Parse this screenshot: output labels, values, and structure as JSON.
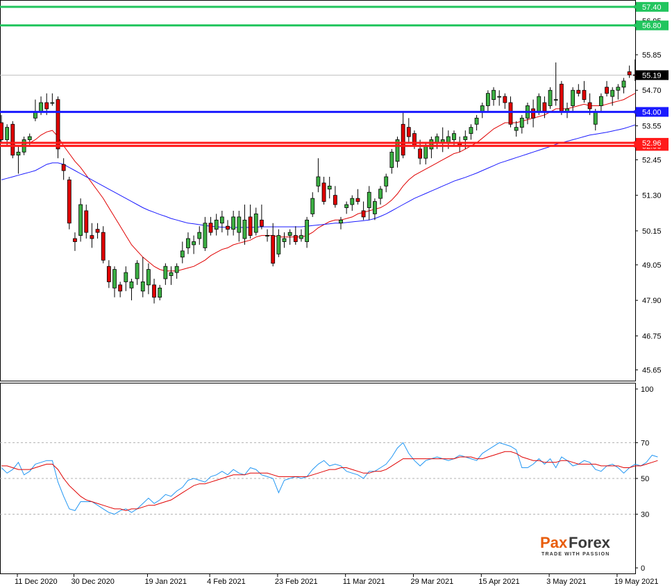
{
  "chart_data": [
    {
      "type": "candlestick",
      "title": "",
      "price_axis_ticks": [
        "56.95",
        "55.85",
        "54.70",
        "53.55",
        "52.45",
        "51.30",
        "50.15",
        "49.05",
        "47.90",
        "46.75",
        "45.65"
      ],
      "ylim": [
        45.3,
        57.6
      ],
      "date_ticks": [
        "11 Dec 2020",
        "30 Dec 2020",
        "19 Jan 2021",
        "4 Feb 2021",
        "23 Feb 2021",
        "11 Mar 2021",
        "29 Mar 2021",
        "15 Apr 2021",
        "3 May 2021",
        "19 May 2021"
      ],
      "date_tick_bar_index": [
        0,
        10,
        23,
        34,
        46,
        58,
        70,
        82,
        94,
        106
      ],
      "candles_ohlc": [
        [
          53.65,
          53.9,
          53.0,
          53.1
        ],
        [
          53.1,
          53.6,
          52.9,
          53.5
        ],
        [
          53.6,
          53.7,
          52.5,
          52.6
        ],
        [
          52.6,
          52.9,
          52.0,
          52.7
        ],
        [
          52.7,
          53.2,
          52.6,
          53.1
        ],
        [
          53.1,
          53.3,
          52.9,
          53.2
        ],
        [
          53.8,
          54.4,
          53.7,
          54.0
        ],
        [
          54.0,
          54.5,
          53.9,
          54.3
        ],
        [
          54.3,
          54.6,
          53.9,
          54.1
        ],
        [
          54.3,
          54.6,
          54.2,
          54.3
        ],
        [
          54.4,
          54.5,
          52.5,
          52.8
        ],
        [
          52.3,
          52.5,
          51.8,
          52.1
        ],
        [
          51.8,
          51.9,
          50.2,
          50.4
        ],
        [
          49.9,
          50.1,
          49.5,
          49.8
        ],
        [
          50.0,
          51.2,
          49.8,
          51.0
        ],
        [
          50.8,
          51.0,
          49.9,
          50.1
        ],
        [
          50.0,
          50.4,
          49.6,
          49.9
        ],
        [
          50.2,
          50.4,
          49.9,
          50.1
        ],
        [
          50.1,
          50.3,
          49.1,
          49.2
        ],
        [
          49.0,
          49.2,
          48.3,
          48.5
        ],
        [
          48.3,
          49.0,
          48.0,
          48.9
        ],
        [
          48.4,
          48.5,
          48.0,
          48.2
        ],
        [
          48.5,
          49.0,
          48.2,
          48.8
        ],
        [
          48.3,
          48.6,
          47.9,
          48.5
        ],
        [
          48.6,
          49.2,
          48.4,
          49.1
        ],
        [
          48.2,
          49.3,
          48.0,
          48.5
        ],
        [
          48.4,
          49.1,
          48.1,
          48.9
        ],
        [
          48.4,
          48.6,
          47.8,
          48.0
        ],
        [
          48.0,
          48.4,
          47.9,
          48.3
        ],
        [
          48.6,
          49.1,
          48.4,
          49.0
        ],
        [
          48.7,
          49.0,
          48.4,
          48.8
        ],
        [
          48.8,
          49.1,
          48.6,
          49.0
        ],
        [
          49.3,
          49.8,
          49.1,
          49.5
        ],
        [
          49.6,
          50.1,
          49.4,
          49.9
        ],
        [
          49.7,
          50.0,
          49.4,
          49.8
        ],
        [
          49.9,
          50.3,
          49.7,
          50.1
        ],
        [
          49.6,
          50.6,
          49.5,
          50.4
        ],
        [
          50.4,
          50.6,
          50.0,
          50.1
        ],
        [
          50.2,
          50.7,
          50.0,
          50.5
        ],
        [
          50.4,
          50.8,
          50.1,
          50.6
        ],
        [
          50.3,
          50.5,
          50.0,
          50.2
        ],
        [
          50.2,
          50.8,
          50.0,
          50.6
        ],
        [
          50.1,
          50.8,
          49.8,
          50.6
        ],
        [
          49.9,
          51.0,
          49.7,
          50.5
        ],
        [
          50.6,
          51.0,
          49.9,
          50.0
        ],
        [
          50.1,
          50.9,
          50.0,
          50.7
        ],
        [
          50.5,
          51.0,
          50.2,
          50.3
        ],
        [
          50.0,
          50.2,
          49.8,
          50.0
        ],
        [
          50.0,
          50.4,
          49.0,
          49.1
        ],
        [
          49.4,
          50.2,
          49.3,
          50.0
        ],
        [
          49.8,
          50.1,
          49.6,
          49.9
        ],
        [
          50.0,
          50.2,
          49.7,
          50.1
        ],
        [
          50.0,
          50.3,
          49.7,
          49.8
        ],
        [
          49.9,
          50.2,
          49.8,
          50.0
        ],
        [
          49.8,
          50.6,
          49.6,
          50.5
        ],
        [
          50.7,
          51.4,
          50.6,
          51.2
        ],
        [
          51.6,
          52.5,
          51.4,
          51.9
        ],
        [
          51.7,
          51.9,
          51.0,
          51.1
        ],
        [
          51.5,
          51.9,
          51.2,
          51.6
        ],
        [
          51.3,
          51.6,
          50.9,
          51.0
        ],
        [
          50.4,
          50.6,
          50.2,
          50.5
        ],
        [
          50.9,
          51.1,
          50.7,
          51.0
        ],
        [
          51.0,
          51.3,
          50.8,
          51.2
        ],
        [
          51.2,
          51.5,
          51.0,
          51.1
        ],
        [
          50.8,
          51.1,
          50.5,
          50.6
        ],
        [
          50.9,
          51.6,
          50.5,
          51.4
        ],
        [
          50.7,
          51.2,
          50.5,
          51.1
        ],
        [
          51.2,
          51.6,
          51.0,
          51.5
        ],
        [
          51.6,
          52.0,
          51.4,
          51.9
        ],
        [
          52.2,
          52.8,
          52.0,
          52.7
        ],
        [
          52.4,
          53.2,
          52.2,
          53.1
        ],
        [
          53.6,
          54.0,
          52.5,
          52.6
        ],
        [
          53.5,
          53.8,
          53.0,
          53.2
        ],
        [
          53.3,
          53.4,
          52.8,
          52.9
        ],
        [
          52.8,
          53.1,
          52.3,
          52.5
        ],
        [
          52.5,
          53.0,
          52.3,
          52.9
        ],
        [
          52.8,
          53.2,
          52.5,
          53.1
        ],
        [
          53.0,
          53.3,
          52.8,
          53.2
        ],
        [
          53.0,
          53.5,
          52.7,
          53.1
        ],
        [
          53.0,
          53.4,
          52.8,
          53.2
        ],
        [
          53.1,
          53.4,
          52.9,
          53.3
        ],
        [
          53.0,
          53.2,
          52.7,
          52.9
        ],
        [
          53.1,
          53.4,
          52.8,
          53.2
        ],
        [
          53.3,
          53.6,
          53.1,
          53.5
        ],
        [
          53.6,
          53.9,
          53.4,
          53.8
        ],
        [
          54.0,
          54.3,
          53.8,
          54.2
        ],
        [
          54.2,
          54.7,
          54.0,
          54.6
        ],
        [
          54.4,
          54.8,
          54.2,
          54.7
        ],
        [
          54.5,
          54.7,
          54.2,
          54.5
        ],
        [
          54.5,
          54.6,
          54.1,
          54.3
        ],
        [
          54.3,
          54.5,
          53.5,
          53.6
        ],
        [
          53.4,
          53.7,
          53.2,
          53.5
        ],
        [
          53.5,
          53.9,
          53.3,
          53.8
        ],
        [
          53.8,
          54.3,
          53.6,
          54.2
        ],
        [
          54.1,
          54.4,
          53.5,
          53.8
        ],
        [
          54.0,
          54.6,
          53.9,
          54.5
        ],
        [
          54.3,
          54.5,
          53.8,
          54.0
        ],
        [
          54.2,
          54.8,
          54.1,
          54.7
        ],
        [
          54.4,
          55.6,
          54.2,
          54.4
        ],
        [
          54.9,
          55.0,
          53.9,
          54.0
        ],
        [
          54.0,
          54.3,
          53.8,
          54.1
        ],
        [
          54.2,
          54.8,
          54.0,
          54.7
        ],
        [
          54.7,
          54.9,
          54.5,
          54.6
        ],
        [
          54.7,
          55.0,
          54.3,
          54.4
        ],
        [
          54.3,
          54.6,
          53.9,
          54.1
        ],
        [
          53.6,
          54.1,
          53.4,
          54.0
        ],
        [
          54.2,
          54.6,
          54.0,
          54.5
        ],
        [
          54.8,
          55.0,
          54.5,
          54.6
        ],
        [
          54.5,
          54.8,
          54.2,
          54.7
        ],
        [
          54.7,
          54.9,
          54.4,
          54.8
        ],
        [
          54.8,
          55.1,
          54.6,
          55.0
        ],
        [
          55.3,
          55.5,
          55.1,
          55.2
        ],
        [
          55.2,
          55.7,
          55.0,
          55.19
        ]
      ],
      "moving_averages": [
        {
          "color": "#e00000",
          "values": [
            53.0,
            53.0,
            52.95,
            52.9,
            52.95,
            53.0,
            53.1,
            53.25,
            53.35,
            53.4,
            53.2,
            52.9,
            52.65,
            52.4,
            52.2,
            51.95,
            51.7,
            51.45,
            51.2,
            50.9,
            50.6,
            50.3,
            50.0,
            49.7,
            49.5,
            49.3,
            49.15,
            49.0,
            48.9,
            48.85,
            48.85,
            48.85,
            48.9,
            48.95,
            49.0,
            49.1,
            49.2,
            49.35,
            49.45,
            49.55,
            49.6,
            49.7,
            49.75,
            49.8,
            49.85,
            49.95,
            50.0,
            50.0,
            50.0,
            49.95,
            49.95,
            49.95,
            49.95,
            49.95,
            50.0,
            50.1,
            50.25,
            50.35,
            50.45,
            50.5,
            50.5,
            50.55,
            50.6,
            50.7,
            50.75,
            50.8,
            50.85,
            50.9,
            51.0,
            51.15,
            51.35,
            51.6,
            51.8,
            51.95,
            52.05,
            52.15,
            52.25,
            52.35,
            52.45,
            52.55,
            52.65,
            52.7,
            52.8,
            52.9,
            53.0,
            53.15,
            53.3,
            53.45,
            53.55,
            53.65,
            53.65,
            53.65,
            53.7,
            53.75,
            53.8,
            53.85,
            53.9,
            54.0,
            54.1,
            54.1,
            54.1,
            54.15,
            54.2,
            54.25,
            54.2,
            54.2,
            54.2,
            54.25,
            54.3,
            54.35,
            54.4,
            54.5,
            54.6
          ]
        },
        {
          "color": "#1a1aff",
          "values": [
            51.8,
            51.85,
            51.9,
            51.95,
            52.0,
            52.05,
            52.1,
            52.2,
            52.3,
            52.35,
            52.35,
            52.3,
            52.2,
            52.1,
            52.0,
            51.9,
            51.8,
            51.7,
            51.6,
            51.5,
            51.4,
            51.3,
            51.2,
            51.1,
            51.0,
            50.9,
            50.82,
            50.75,
            50.68,
            50.62,
            50.55,
            50.5,
            50.45,
            50.4,
            50.38,
            50.35,
            50.32,
            50.3,
            50.28,
            50.27,
            50.26,
            50.26,
            50.26,
            50.26,
            50.26,
            50.27,
            50.28,
            50.28,
            50.28,
            50.28,
            50.28,
            50.28,
            50.28,
            50.28,
            50.3,
            50.32,
            50.34,
            50.36,
            50.38,
            50.4,
            50.4,
            50.42,
            50.44,
            50.46,
            50.48,
            50.5,
            50.55,
            50.62,
            50.7,
            50.8,
            50.9,
            51.0,
            51.1,
            51.2,
            51.28,
            51.36,
            51.44,
            51.52,
            51.6,
            51.68,
            51.76,
            51.82,
            51.88,
            51.95,
            52.02,
            52.1,
            52.18,
            52.26,
            52.34,
            52.4,
            52.46,
            52.52,
            52.58,
            52.64,
            52.7,
            52.76,
            52.82,
            52.88,
            52.95,
            53.0,
            53.05,
            53.1,
            53.15,
            53.2,
            53.25,
            53.28,
            53.31,
            53.34,
            53.38,
            53.42,
            53.46,
            53.52,
            53.58
          ]
        }
      ],
      "horizontal_levels": [
        {
          "label": "57.40",
          "color": "#22c55e",
          "value": 57.4
        },
        {
          "label": "56.80",
          "color": "#22c55e",
          "value": 56.8
        },
        {
          "label": "54.00",
          "color": "#1a1aff",
          "value": 54.0
        },
        {
          "label": "52.90",
          "color": "#ff1a1a",
          "value": 52.9
        },
        {
          "label": "52.96",
          "color": "#ff1a1a",
          "value": 53.0
        }
      ],
      "current_price": "55.19",
      "bull_color": "#3cb043",
      "bear_color": "#e00000"
    },
    {
      "type": "line",
      "title": "",
      "ylim": [
        0,
        100
      ],
      "y_ticks": [
        "100",
        "70",
        "50",
        "30",
        "0"
      ],
      "y_tick_values": [
        100,
        70,
        50,
        30,
        0
      ],
      "dashed_levels": [
        70,
        50,
        30
      ],
      "series": [
        {
          "color": "#2196f3",
          "values": [
            56,
            53,
            55,
            59,
            52,
            54,
            58,
            59,
            60,
            60,
            48,
            40,
            33,
            32,
            37,
            37,
            37,
            35,
            33,
            31,
            30,
            32,
            33,
            31,
            33,
            36,
            39,
            36,
            38,
            41,
            40,
            43,
            45,
            49,
            50,
            49,
            48,
            51,
            52,
            54,
            52,
            55,
            53,
            52,
            56,
            55,
            52,
            51,
            50,
            42,
            49,
            50,
            51,
            50,
            51,
            55,
            58,
            60,
            57,
            58,
            57,
            54,
            53,
            52,
            50,
            54,
            54,
            56,
            58,
            62,
            67,
            70,
            64,
            60,
            57,
            60,
            61,
            62,
            61,
            60,
            61,
            63,
            62,
            61,
            60,
            64,
            66,
            68,
            70,
            69,
            68,
            66,
            56,
            56,
            58,
            61,
            58,
            61,
            56,
            62,
            60,
            57,
            58,
            60,
            59,
            55,
            54,
            57,
            58,
            56,
            53,
            56,
            58,
            57,
            59,
            63,
            62
          ]
        },
        {
          "color": "#e00000",
          "values": [
            57,
            57,
            56,
            55,
            55,
            55,
            56,
            57,
            58,
            58,
            55,
            50,
            46,
            43,
            40,
            38,
            37,
            36,
            35,
            34,
            33,
            33,
            32,
            33,
            33,
            34,
            35,
            35,
            36,
            37,
            38,
            40,
            42,
            44,
            46,
            47,
            47,
            48,
            49,
            50,
            51,
            52,
            52,
            52,
            53,
            53,
            53,
            53,
            52,
            51,
            51,
            51,
            51,
            51,
            51,
            52,
            53,
            54,
            55,
            55,
            56,
            56,
            55,
            54,
            53,
            53,
            54,
            54,
            55,
            57,
            59,
            61,
            61,
            61,
            61,
            61,
            61,
            61,
            61,
            61,
            61,
            62,
            62,
            62,
            61,
            61,
            62,
            63,
            64,
            65,
            65,
            64,
            62,
            61,
            60,
            60,
            59,
            59,
            59,
            60,
            60,
            59,
            58,
            58,
            58,
            58,
            57,
            57,
            57,
            57,
            56,
            56,
            57,
            57,
            58,
            59,
            60
          ]
        }
      ]
    }
  ],
  "logo": {
    "text_left": "Pa",
    "text_x": "x",
    "text_right": "Forex",
    "tagline": "TRADE WITH PASSION"
  }
}
